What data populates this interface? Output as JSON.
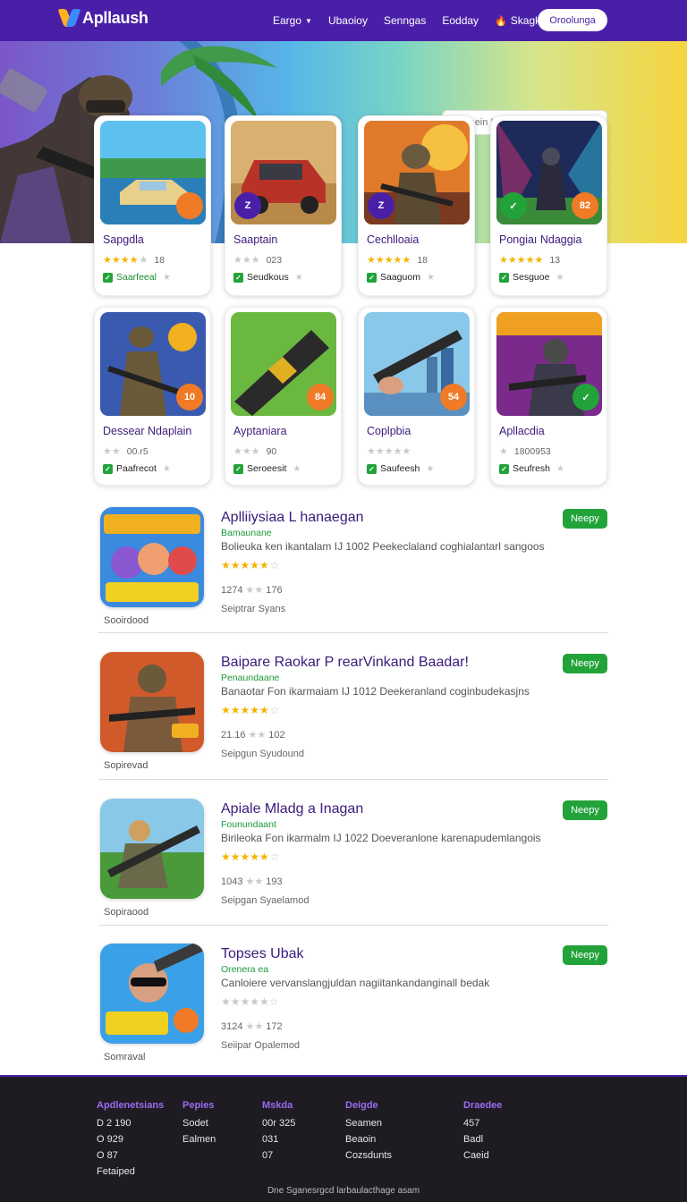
{
  "header": {
    "logo_text": "Apllaush",
    "nav": [
      {
        "label": "Eargo",
        "caret": true
      },
      {
        "label": "Ubaoioy",
        "caret": false
      },
      {
        "label": "Senngas",
        "caret": false
      },
      {
        "label": "Eodday",
        "caret": false
      },
      {
        "label": "Skagko",
        "caret": true,
        "flame": true
      }
    ],
    "button_label": "Oroolunga"
  },
  "search": {
    "placeholder": "Segaein UIJO Ah ★"
  },
  "grid": [
    {
      "title": "Sapgdla",
      "rating_stars": 4,
      "rating_text": "18",
      "status": "Saarfeeal",
      "status_green": true,
      "badge": "",
      "badge_color": "#f07a26",
      "badge_side": "right"
    },
    {
      "title": "Saaptain",
      "rating_stars": 0,
      "rating_text": "023",
      "status": "Seudkous",
      "status_green": false,
      "badge": "Z",
      "badge_color": "#4a1fa8",
      "badge_side": "left"
    },
    {
      "title": "Cechlloaia",
      "rating_stars": 5,
      "rating_text": "18",
      "status": "Saaguom",
      "status_green": false,
      "badge": "Z",
      "badge_color": "#4a1fa8",
      "badge_side": "left"
    },
    {
      "title": "Pongiaı Ndaggia",
      "rating_stars": 5,
      "rating_text": "13",
      "status": "Sesguoe",
      "status_green": false,
      "badge": "82",
      "badge_color": "#f07a26",
      "badge_side": "right"
    },
    {
      "title": "Dessear Ndaplain",
      "rating_stars": 0,
      "rating_text": "00.r5",
      "status": "Paafrecot",
      "status_green": false,
      "badge": "10",
      "badge_color": "#f07a26",
      "badge_side": "right"
    },
    {
      "title": "Ayptaniara",
      "rating_stars": 0,
      "rating_text": "90",
      "status": "Seroeesit",
      "status_green": false,
      "badge": "84",
      "badge_color": "#f07a26",
      "badge_side": "right"
    },
    {
      "title": "Coplpbia",
      "rating_stars": 0,
      "rating_text": "",
      "status": "Saufeesh",
      "status_green": false,
      "badge": "54",
      "badge_color": "#f07a26",
      "badge_side": "right"
    },
    {
      "title": "Apllacdia",
      "rating_stars": 0,
      "rating_text": "1800953",
      "status": "Seufresh",
      "status_green": false,
      "badge": "",
      "badge_color": "#22a33a",
      "badge_side": "right"
    }
  ],
  "list": [
    {
      "title": "Aplliiysiaa L hanaegan",
      "sub": "Bamaunane",
      "desc": "Bolieuka ken ikantalam IJ 1002 Peekeclaland coghialantarl sangoos",
      "stars": 5,
      "stats_a": "1274",
      "stats_b": "176",
      "meta": "Seiptrar Syans",
      "caption": "Sooirdood",
      "button": "Neepy"
    },
    {
      "title": "Baipare Raokar P rearVinkand Baadar!",
      "sub": "Penaundaane",
      "desc": "Banaotar Fon ikarmaiam IJ 1012 Deekeranland coginbudekasjns",
      "stars": 5,
      "stats_a": "21.16",
      "stats_b": "102",
      "meta": "Seipgun Syudound",
      "caption": "Sopirevad",
      "button": "Neepy"
    },
    {
      "title": "Apiale Mladg a Inagan",
      "sub": "Founundaant",
      "desc": "Birileoka Fon ikarmalm IJ 1022 Doeveranlone karenapudemlangois",
      "stars": 5,
      "stats_a": "1043",
      "stats_b": "193",
      "meta": "Seipgan Syaelamod",
      "caption": "Sopiraood",
      "button": "Neepy"
    },
    {
      "title": "Topses Ubak",
      "sub": "Orenera ea",
      "desc": "Canloiere vervanslangjuldan nagiitankandanginall bedak",
      "stars": 0,
      "stats_a": "3124",
      "stats_b": "172",
      "meta": "Seiipar Opalemod",
      "caption": "Somraval",
      "button": "Neepy"
    }
  ],
  "footer": {
    "columns": [
      {
        "head": "Apdlenetsians",
        "lines": [
          "D  2 190",
          "O  929",
          "O  87",
          "Fetaiped"
        ]
      },
      {
        "head": "Pepies",
        "lines": [
          "Sodet",
          "Ealmen"
        ]
      },
      {
        "head": "Mskda",
        "lines": [
          "00r 325",
          "031",
          "07"
        ]
      },
      {
        "head": "Deigde",
        "lines": [
          "Seamen",
          "Beaoin",
          "Cozsdunts"
        ]
      },
      {
        "head": "Draedee",
        "lines": [
          "457",
          "Badl",
          "Caeid"
        ]
      }
    ],
    "copyright": "Dne  Sganesrgcd larbaulacthage asam"
  },
  "colors": {
    "brand": "#4a1fa8",
    "accent_green": "#22a33a",
    "star": "#f4b400",
    "footer_bg": "#1e1c22"
  }
}
